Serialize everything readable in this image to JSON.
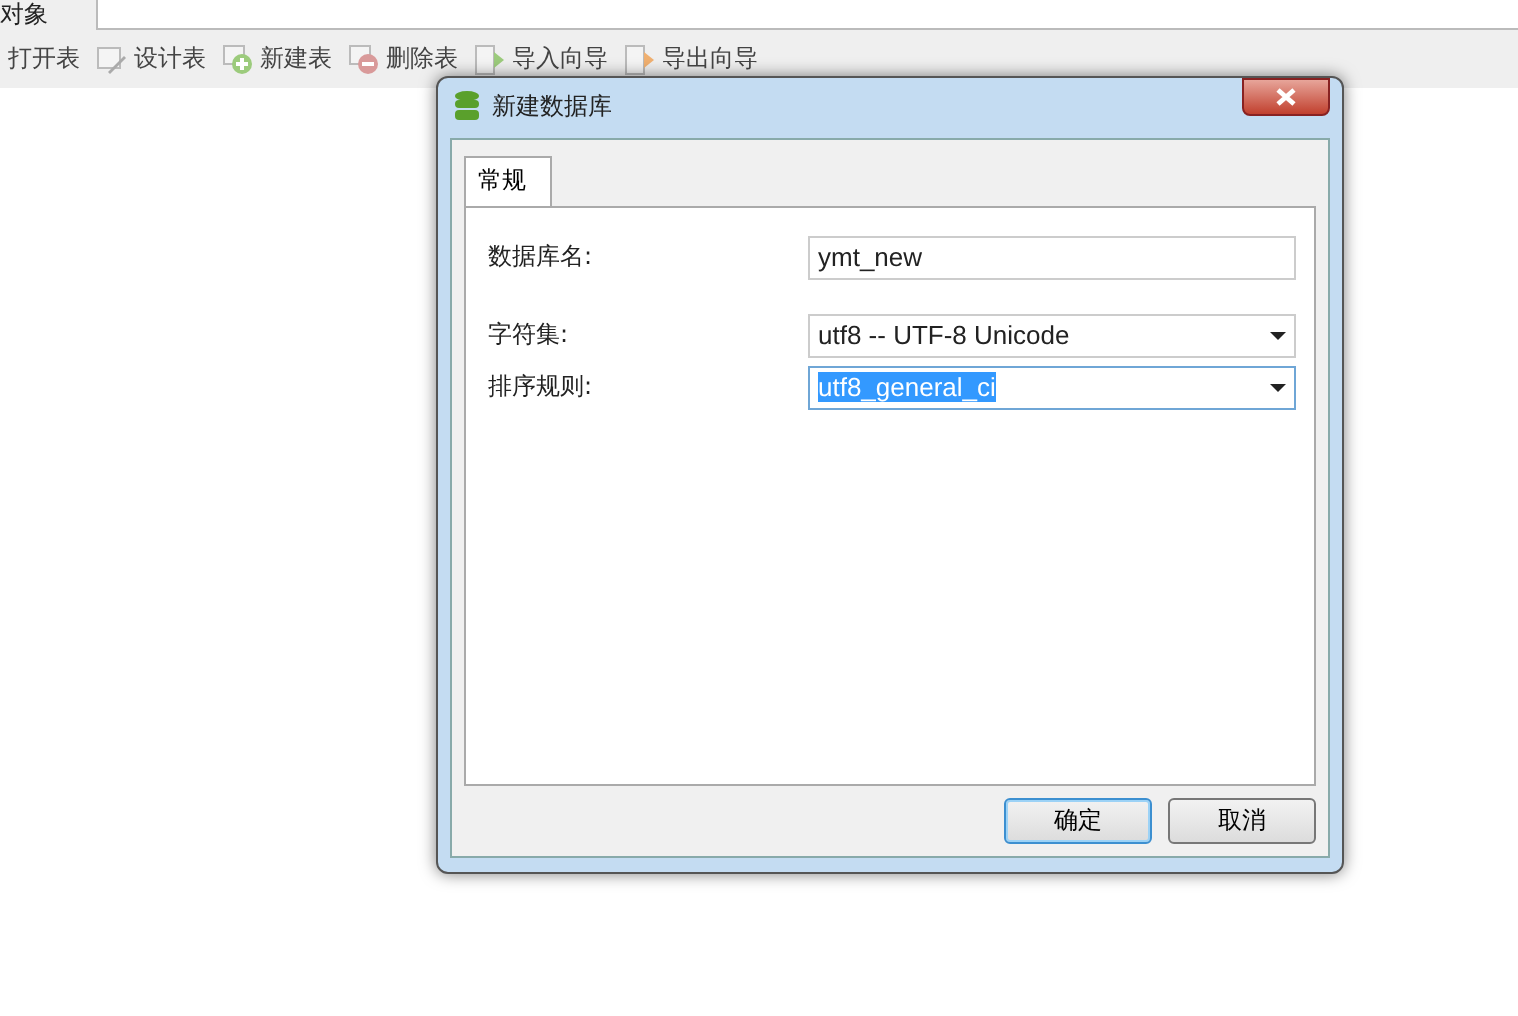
{
  "top_tab": {
    "label": "对象"
  },
  "toolbar": [
    {
      "label": "打开表",
      "kind": "open"
    },
    {
      "label": "设计表",
      "kind": "design"
    },
    {
      "label": "新建表",
      "kind": "new"
    },
    {
      "label": "删除表",
      "kind": "delete"
    },
    {
      "label": "导入向导",
      "kind": "import"
    },
    {
      "label": "导出向导",
      "kind": "export"
    }
  ],
  "dialog": {
    "title": "新建数据库",
    "tabs": [
      {
        "label": "常规",
        "selected": true
      }
    ],
    "fields": [
      {
        "label": "数据库名:",
        "kind": "text",
        "value": "ymt_new",
        "highlighted": false
      },
      {
        "label": "字符集:",
        "kind": "select",
        "value": "utf8 -- UTF-8 Unicode",
        "highlighted": false
      },
      {
        "label": "排序规则:",
        "kind": "select",
        "value": "utf8_general_ci",
        "highlighted": true
      }
    ],
    "buttons": [
      {
        "label": "确定",
        "default": true
      },
      {
        "label": "取消",
        "default": false
      }
    ]
  }
}
